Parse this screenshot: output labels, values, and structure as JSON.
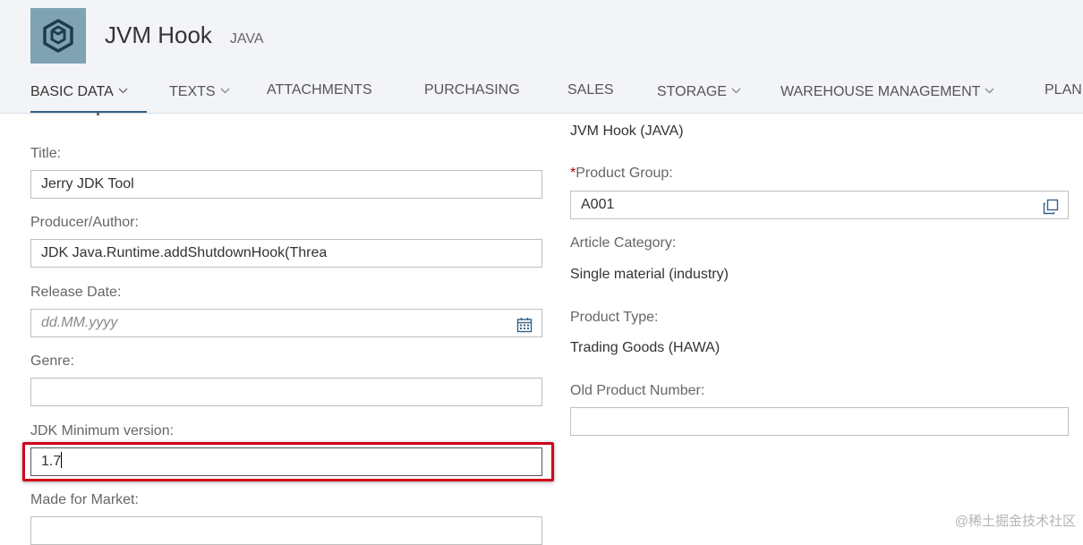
{
  "header": {
    "title": "JVM Hook",
    "subtitle": "JAVA",
    "icon": "box-icon"
  },
  "tabs": [
    {
      "label": "BASIC DATA",
      "dropdown": true,
      "active": true
    },
    {
      "label": "TEXTS",
      "dropdown": true
    },
    {
      "label": "ATTACHMENTS",
      "dropdown": false
    },
    {
      "label": "PURCHASING",
      "dropdown": false
    },
    {
      "label": "SALES",
      "dropdown": false
    },
    {
      "label": "STORAGE",
      "dropdown": true
    },
    {
      "label": "WAREHOUSE MANAGEMENT",
      "dropdown": true
    },
    {
      "label": "PLAN",
      "dropdown": false
    }
  ],
  "left": {
    "title_label": "Title:",
    "title_value": "Jerry JDK Tool",
    "producer_label": "Producer/Author:",
    "producer_value": "JDK Java.Runtime.addShutdownHook(Threa",
    "release_label": "Release Date:",
    "release_placeholder": "dd.MM.yyyy",
    "genre_label": "Genre:",
    "genre_value": "",
    "jdk_label": "JDK Minimum version:",
    "jdk_value": "1.7",
    "market_label": "Made for Market:",
    "market_value": ""
  },
  "right": {
    "product_name": "JVM Hook (JAVA)",
    "required_mark": "*",
    "product_group_label": "Product Group:",
    "product_group_value": "A001",
    "article_category_label": "Article Category:",
    "article_category_value": "Single material (industry)",
    "product_type_label": "Product Type:",
    "product_type_value": "Trading Goods (HAWA)",
    "old_number_label": "Old Product Number:",
    "old_number_value": ""
  },
  "colors": {
    "header_bg": "#f2f4f7",
    "tab_underline": "#346187",
    "highlight_border": "#d0021b",
    "required": "#bb0000"
  },
  "watermark": "@稀土掘金技术社区"
}
